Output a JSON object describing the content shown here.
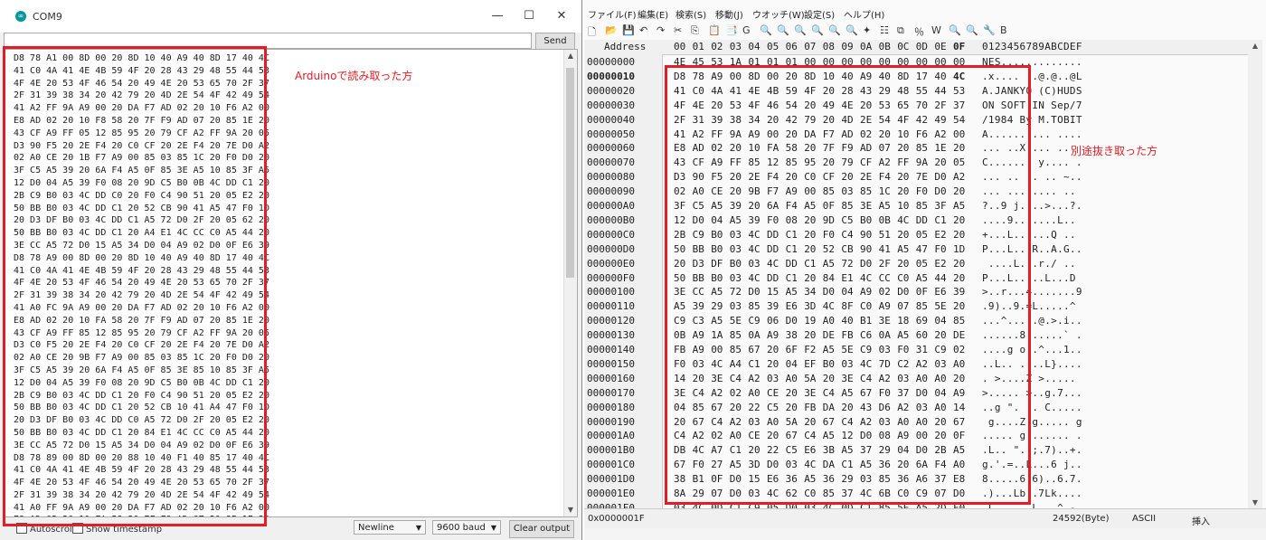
{
  "serial_monitor": {
    "title": "COM9",
    "app_icon": "arduino-icon",
    "window_controls": [
      "—",
      "☐",
      "✕"
    ],
    "send_label": "Send",
    "command_input": "",
    "output_lines": [
      "D8 78 A1 00 8D 00 20 8D 10 40 A9 40 8D 17 40 4C",
      "41 C0 4A 41 4E 4B 59 4F 20 28 43 29 48 55 44 53",
      "4F 4E 20 53 4F 46 54 20 49 4E 20 53 65 70 2F 37",
      "2F 31 39 38 34 20 42 79 20 4D 2E 54 4F 42 49 54",
      "41 A2 FF 9A A9 00 20 DA F7 AD 02 20 10 F6 A2 00",
      "E8 AD 02 20 10 F8 58 20 7F F9 AD 07 20 85 1E 20",
      "43 CF A9 FF 05 12 85 95 20 79 CF A2 FF 9A 20 05",
      "D3 90 F5 20 2E F4 20 C0 CF 20 2E F4 20 7E D0 A2",
      "02 A0 CE 20 1B F7 A9 00 85 03 85 1C 20 F0 D0 20",
      "3F C5 A5 39 20 6A F4 A5 0F 85 3E A5 10 85 3F A5",
      "12 D0 04 A5 39 F0 08 20 9D C5 B0 0B 4C DD C1 20",
      "2B C9 B0 03 4C DD C0 20 F0 C4 90 51 20 05 E2 20",
      "50 BB B0 03 4C DD C1 20 52 CB 90 41 A5 47 F0 1D",
      "20 D3 DF B0 03 4C DD C1 A5 72 D0 2F 20 05 62 20",
      "50 BB B0 03 4C DD C1 20 A4 E1 4C CC C0 A5 44 20",
      "3E CC A5 72 D0 15 A5 34 D0 04 A9 02 D0 0F E6 39",
      "D8 78 A9 00 8D 00 20 8D 10 40 A9 40 8D 17 40 4C",
      "41 C0 4A 41 4E 4B 59 4F 20 28 43 29 48 55 44 53",
      "4F 4E 20 53 4F 46 54 20 49 4E 20 53 65 70 2F 37",
      "2F 31 39 38 34 20 42 79 20 4D 2E 54 4F 42 49 54",
      "41 A0 FC 9A A9 00 20 DA F7 AD 02 20 10 F6 A2 00",
      "E8 AD 02 20 10 FA 58 20 7F F9 AD 07 20 85 1E 20",
      "43 CF A9 FF 85 12 85 95 20 79 CF A2 FF 9A 20 05",
      "D3 C0 F5 20 2E F4 20 C0 CF 20 2E F4 20 7E D0 A2",
      "02 A0 CE 20 9B F7 A9 00 85 03 85 1C 20 F0 D0 20",
      "3F C5 A5 39 20 6A F4 A5 0F 85 3E 85 10 85 3F A5",
      "12 D0 04 A5 39 F0 08 20 9D C5 B0 0B 4C DD C1 20",
      "2B C9 B0 03 4C DD C1 20 F0 C4 90 51 20 05 E2 20",
      "50 BB B0 03 4C DD C1 20 52 CB 10 41 A4 47 F0 1D",
      "20 D3 DF B0 03 4C DD C0 A5 72 D0 2F 20 05 E2 20",
      "50 BB B0 03 4C DD C1 20 84 E1 4C CC C0 A5 44 20",
      "3E CC A5 72 D0 15 A5 34 D0 04 A9 02 D0 0F E6 39",
      "D8 78 89 00 8D 00 20 88 10 40 F1 40 85 17 40 4C",
      "41 C0 4A 41 4E 4B 59 4F 20 28 43 29 48 55 44 53",
      "4F 4E 20 53 4F 46 54 20 49 4E 20 53 65 70 2F 37",
      "2F 31 39 38 34 20 42 79 20 4D 2E 54 4F 42 49 54",
      "41 A0 FF 9A A9 00 20 DA F7 AD 02 20 10 F6 A2 00",
      "E8 AD 02 20 10 FA 58 20 7F F9 AD 07 20 85 1E 20"
    ],
    "autoscroll_label": "Autoscroll",
    "timestamp_label": "Show timestamp",
    "line_ending": "Newline",
    "baud_rate": "9600 baud",
    "clear_label": "Clear output",
    "annotation": "Arduinoで読み取った方"
  },
  "hex_editor": {
    "menu": [
      "ファイル(F)",
      "編集(E)",
      "検索(S)",
      "移動(J)",
      "ウオッチ(W)",
      "設定(S)",
      "ヘルプ(H)"
    ],
    "toolbar_icons": [
      "new-file-icon",
      "open-folder-icon",
      "save-icon",
      "undo-icon",
      "redo-icon",
      "cut-icon",
      "copy-icon",
      "paste-icon",
      "paste-special-icon",
      "goto-icon",
      "search-icon",
      "search-next-icon",
      "search-prev-icon",
      "zoom-icon",
      "zoom-in-icon",
      "zoom-out-icon",
      "bookmark-icon",
      "list-icon",
      "compare-icon",
      "char-icon",
      "watch-icon",
      "find-icon",
      "find-next-icon",
      "tool-icon",
      "bold-icon"
    ],
    "toolbar_glyphs": [
      "🗋",
      "📂",
      "💾",
      "↶",
      "↷",
      "✂",
      "⎘",
      "📋",
      "📑",
      "G",
      "🔍",
      "🔍",
      "🔍",
      "🔍",
      "🔍",
      "🔍",
      "✦",
      "☷",
      "⧉",
      "％",
      "W",
      "🔍",
      "🔍",
      "🔧",
      "B"
    ],
    "address_label": "Address",
    "col_headers": [
      "00",
      "01",
      "02",
      "03",
      "04",
      "05",
      "06",
      "07",
      "08",
      "09",
      "0A",
      "0B",
      "0C",
      "0D",
      "0E",
      "0F"
    ],
    "ascii_header": "0123456789ABCDEF",
    "rows": [
      {
        "addr": "00000000",
        "bytes": [
          "4E",
          "45",
          "53",
          "1A",
          "01",
          "01",
          "01",
          "00",
          "00",
          "00",
          "00",
          "00",
          "00",
          "00",
          "00",
          "00"
        ],
        "ascii": "NES............."
      },
      {
        "addr": "00000010",
        "bytes": [
          "D8",
          "78",
          "A9",
          "00",
          "8D",
          "00",
          "20",
          "8D",
          "10",
          "40",
          "A9",
          "40",
          "8D",
          "17",
          "40",
          "4C"
        ],
        "ascii": ".x.... ..@.@..@L"
      },
      {
        "addr": "00000020",
        "bytes": [
          "41",
          "C0",
          "4A",
          "41",
          "4E",
          "4B",
          "59",
          "4F",
          "20",
          "28",
          "43",
          "29",
          "48",
          "55",
          "44",
          "53"
        ],
        "ascii": "A.JANKYO (C)HUDS"
      },
      {
        "addr": "00000030",
        "bytes": [
          "4F",
          "4E",
          "20",
          "53",
          "4F",
          "46",
          "54",
          "20",
          "49",
          "4E",
          "20",
          "53",
          "65",
          "70",
          "2F",
          "37"
        ],
        "ascii": "ON SOFT IN Sep/7"
      },
      {
        "addr": "00000040",
        "bytes": [
          "2F",
          "31",
          "39",
          "38",
          "34",
          "20",
          "42",
          "79",
          "20",
          "4D",
          "2E",
          "54",
          "4F",
          "42",
          "49",
          "54"
        ],
        "ascii": "/1984 By M.TOBIT"
      },
      {
        "addr": "00000050",
        "bytes": [
          "41",
          "A2",
          "FF",
          "9A",
          "A9",
          "00",
          "20",
          "DA",
          "F7",
          "AD",
          "02",
          "20",
          "10",
          "F6",
          "A2",
          "00"
        ],
        "ascii": "A...... ... ...."
      },
      {
        "addr": "00000060",
        "bytes": [
          "E8",
          "AD",
          "02",
          "20",
          "10",
          "FA",
          "58",
          "20",
          "7F",
          "F9",
          "AD",
          "07",
          "20",
          "85",
          "1E",
          "20"
        ],
        "ascii": "... ..X ... .. "
      },
      {
        "addr": "00000070",
        "bytes": [
          "43",
          "CF",
          "A9",
          "FF",
          "85",
          "12",
          "85",
          "95",
          "20",
          "79",
          "CF",
          "A2",
          "FF",
          "9A",
          "20",
          "05"
        ],
        "ascii": "C....... y.... ."
      },
      {
        "addr": "00000080",
        "bytes": [
          "D3",
          "90",
          "F5",
          "20",
          "2E",
          "F4",
          "20",
          "C0",
          "CF",
          "20",
          "2E",
          "F4",
          "20",
          "7E",
          "D0",
          "A2"
        ],
        "ascii": "... .. .. .. ~.."
      },
      {
        "addr": "00000090",
        "bytes": [
          "02",
          "A0",
          "CE",
          "20",
          "9B",
          "F7",
          "A9",
          "00",
          "85",
          "03",
          "85",
          "1C",
          "20",
          "F0",
          "D0",
          "20"
        ],
        "ascii": "... ........ .. "
      },
      {
        "addr": "000000A0",
        "bytes": [
          "3F",
          "C5",
          "A5",
          "39",
          "20",
          "6A",
          "F4",
          "A5",
          "0F",
          "85",
          "3E",
          "A5",
          "10",
          "85",
          "3F",
          "A5"
        ],
        "ascii": "?..9 j....>...?."
      },
      {
        "addr": "000000B0",
        "bytes": [
          "12",
          "D0",
          "04",
          "A5",
          "39",
          "F0",
          "08",
          "20",
          "9D",
          "C5",
          "B0",
          "0B",
          "4C",
          "DD",
          "C1",
          "20"
        ],
        "ascii": "....9.. ....L.. "
      },
      {
        "addr": "000000C0",
        "bytes": [
          "2B",
          "C9",
          "B0",
          "03",
          "4C",
          "DD",
          "C1",
          "20",
          "F0",
          "C4",
          "90",
          "51",
          "20",
          "05",
          "E2",
          "20"
        ],
        "ascii": "+...L.. ...Q .. "
      },
      {
        "addr": "000000D0",
        "bytes": [
          "50",
          "BB",
          "B0",
          "03",
          "4C",
          "DD",
          "C1",
          "20",
          "52",
          "CB",
          "90",
          "41",
          "A5",
          "47",
          "F0",
          "1D"
        ],
        "ascii": "P...L.. R..A.G.."
      },
      {
        "addr": "000000E0",
        "bytes": [
          "20",
          "D3",
          "DF",
          "B0",
          "03",
          "4C",
          "DD",
          "C1",
          "A5",
          "72",
          "D0",
          "2F",
          "20",
          "05",
          "E2",
          "20"
        ],
        "ascii": " ....L...r./ .. "
      },
      {
        "addr": "000000F0",
        "bytes": [
          "50",
          "BB",
          "B0",
          "03",
          "4C",
          "DD",
          "C1",
          "20",
          "84",
          "E1",
          "4C",
          "CC",
          "C0",
          "A5",
          "44",
          "20"
        ],
        "ascii": "P...L.. ..L...D "
      },
      {
        "addr": "00000100",
        "bytes": [
          "3E",
          "CC",
          "A5",
          "72",
          "D0",
          "15",
          "A5",
          "34",
          "D0",
          "04",
          "A9",
          "02",
          "D0",
          "0F",
          "E6",
          "39"
        ],
        "ascii": ">..r...4.......9"
      },
      {
        "addr": "00000110",
        "bytes": [
          "A5",
          "39",
          "29",
          "03",
          "85",
          "39",
          "E6",
          "3D",
          "4C",
          "8F",
          "C0",
          "A9",
          "07",
          "85",
          "5E",
          "20"
        ],
        "ascii": ".9)..9.=L.....^ "
      },
      {
        "addr": "00000120",
        "bytes": [
          "C9",
          "C3",
          "A5",
          "5E",
          "C9",
          "06",
          "D0",
          "19",
          "A0",
          "40",
          "B1",
          "3E",
          "18",
          "69",
          "04",
          "85"
        ],
        "ascii": "...^.....@.>.i.."
      },
      {
        "addr": "00000130",
        "bytes": [
          "0B",
          "A9",
          "1A",
          "85",
          "0A",
          "A9",
          "38",
          "20",
          "DE",
          "FB",
          "C6",
          "0A",
          "A5",
          "60",
          "20",
          "DE"
        ],
        "ascii": "......8 .....` ."
      },
      {
        "addr": "00000140",
        "bytes": [
          "FB",
          "A9",
          "00",
          "85",
          "67",
          "20",
          "6F",
          "F2",
          "A5",
          "5E",
          "C9",
          "03",
          "F0",
          "31",
          "C9",
          "02"
        ],
        "ascii": "....g o..^...1.."
      },
      {
        "addr": "00000150",
        "bytes": [
          "F0",
          "03",
          "4C",
          "A4",
          "C1",
          "20",
          "04",
          "EF",
          "B0",
          "03",
          "4C",
          "7D",
          "C2",
          "A2",
          "03",
          "A0"
        ],
        "ascii": "..L.. ....L}...."
      },
      {
        "addr": "00000160",
        "bytes": [
          "14",
          "20",
          "3E",
          "C4",
          "A2",
          "03",
          "A0",
          "5A",
          "20",
          "3E",
          "C4",
          "A2",
          "03",
          "A0",
          "A0",
          "20"
        ],
        "ascii": ". >....Z >..... "
      },
      {
        "addr": "00000170",
        "bytes": [
          "3E",
          "C4",
          "A2",
          "02",
          "A0",
          "CE",
          "20",
          "3E",
          "C4",
          "A5",
          "67",
          "F0",
          "37",
          "D0",
          "04",
          "A9"
        ],
        "ascii": ">..... >..g.7..."
      },
      {
        "addr": "00000180",
        "bytes": [
          "04",
          "85",
          "67",
          "20",
          "22",
          "C5",
          "20",
          "FB",
          "DA",
          "20",
          "43",
          "D6",
          "A2",
          "03",
          "A0",
          "14"
        ],
        "ascii": "..g \". .. C....."
      },
      {
        "addr": "00000190",
        "bytes": [
          "20",
          "67",
          "C4",
          "A2",
          "03",
          "A0",
          "5A",
          "20",
          "67",
          "C4",
          "A2",
          "03",
          "A0",
          "A0",
          "20",
          "67"
        ],
        "ascii": " g....Z g..... g"
      },
      {
        "addr": "000001A0",
        "bytes": [
          "C4",
          "A2",
          "02",
          "A0",
          "CE",
          "20",
          "67",
          "C4",
          "A5",
          "12",
          "D0",
          "08",
          "A9",
          "00",
          "20",
          "0F"
        ],
        "ascii": "..... g....... ."
      },
      {
        "addr": "000001B0",
        "bytes": [
          "DB",
          "4C",
          "A7",
          "C1",
          "20",
          "22",
          "C5",
          "E6",
          "3B",
          "A5",
          "37",
          "29",
          "04",
          "D0",
          "2B",
          "A5"
        ],
        "ascii": ".L.. \"..;.7)..+."
      },
      {
        "addr": "000001C0",
        "bytes": [
          "67",
          "F0",
          "27",
          "A5",
          "3D",
          "D0",
          "03",
          "4C",
          "DA",
          "C1",
          "A5",
          "36",
          "20",
          "6A",
          "F4",
          "A0"
        ],
        "ascii": "g.'.=..L...6 j.."
      },
      {
        "addr": "000001D0",
        "bytes": [
          "38",
          "B1",
          "0F",
          "D0",
          "15",
          "E6",
          "36",
          "A5",
          "36",
          "29",
          "03",
          "85",
          "36",
          "A6",
          "37",
          "E8"
        ],
        "ascii": "8.....6.6)..6.7."
      },
      {
        "addr": "000001E0",
        "bytes": [
          "8A",
          "29",
          "07",
          "D0",
          "03",
          "4C",
          "62",
          "C0",
          "85",
          "37",
          "4C",
          "6B",
          "C0",
          "C9",
          "07",
          "D0"
        ],
        "ascii": ".)...Lb..7Lk...."
      },
      {
        "addr": "000001F0",
        "bytes": [
          "03",
          "4C",
          "0D",
          "C1",
          "C9",
          "05",
          "D0",
          "03",
          "4C",
          "0D",
          "C1",
          "85",
          "5E",
          "A5",
          "2D",
          "F0"
        ],
        "ascii": ".L......L...^.-."
      }
    ],
    "cursor_address": "0x0000001F",
    "file_size": "24592(Byte)",
    "encoding": "ASCII",
    "mode": "挿入",
    "annotation": "別途抜き取った方"
  },
  "colors": {
    "highlight_box": "#e51c23"
  }
}
